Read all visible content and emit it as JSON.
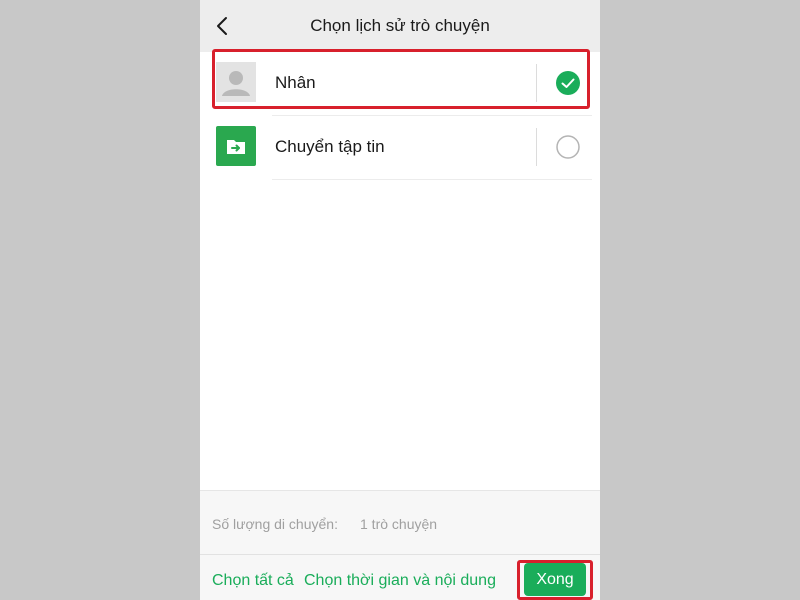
{
  "header": {
    "title": "Chọn lịch sử trò chuyện",
    "back_icon": "chevron-left-icon"
  },
  "chats": [
    {
      "name": "Nhân",
      "avatar_icon": "user-avatar-icon",
      "selected": true
    },
    {
      "name": "Chuyển tập tin",
      "avatar_icon": "file-transfer-icon",
      "selected": false
    }
  ],
  "summary": {
    "label": "Số lượng di chuyển:",
    "value": "1 trò chuyện"
  },
  "footer": {
    "select_all": "Chọn tất cả",
    "select_time_content": "Chọn thời gian và nội dung",
    "done": "Xong"
  },
  "colors": {
    "accent": "#1aad5a",
    "highlight": "#d8202c",
    "header_bg": "#ededed",
    "outer_bg": "#c8c8c8"
  }
}
